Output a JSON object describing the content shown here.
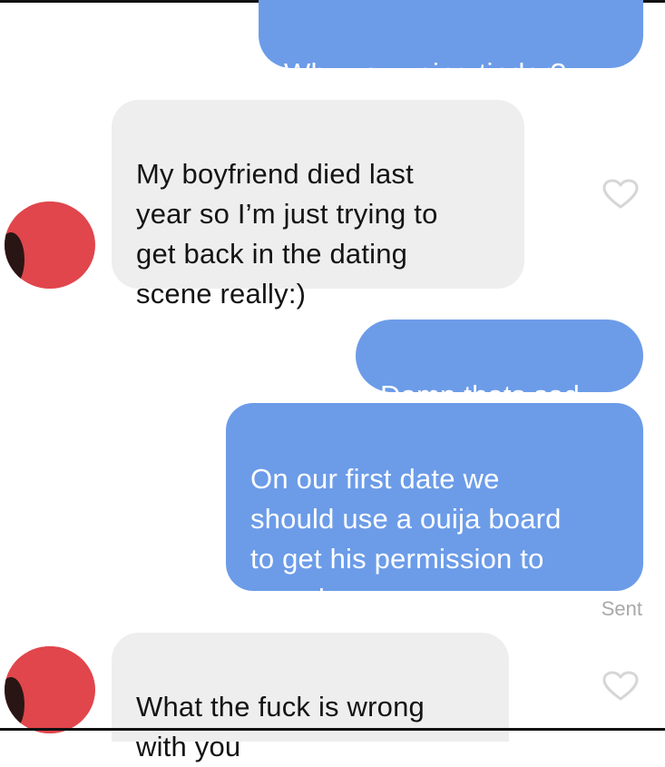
{
  "conversation": {
    "messages": [
      {
        "sender": "me",
        "text": "Why you using tinder?"
      },
      {
        "sender": "match",
        "text": "My boyfriend died last\nyear so I’m just trying to\nget back in the dating\nscene really:)"
      },
      {
        "sender": "me",
        "text": "Damn thats sad"
      },
      {
        "sender": "me",
        "text": "On our first date we\nshould use a ouija board\nto get his permission to\nsmash"
      },
      {
        "sender": "match",
        "text": "What the fuck is wrong\nwith you"
      }
    ],
    "sent_status": "Sent",
    "colors": {
      "sent_bubble": "#6c9ce8",
      "received_bubble": "#eeeeef",
      "avatar": "#e0464c",
      "heart_outline": "#d6d6d6"
    },
    "icons": {
      "like": "heart-outline-icon",
      "avatar": "profile-avatar-redacted"
    }
  }
}
